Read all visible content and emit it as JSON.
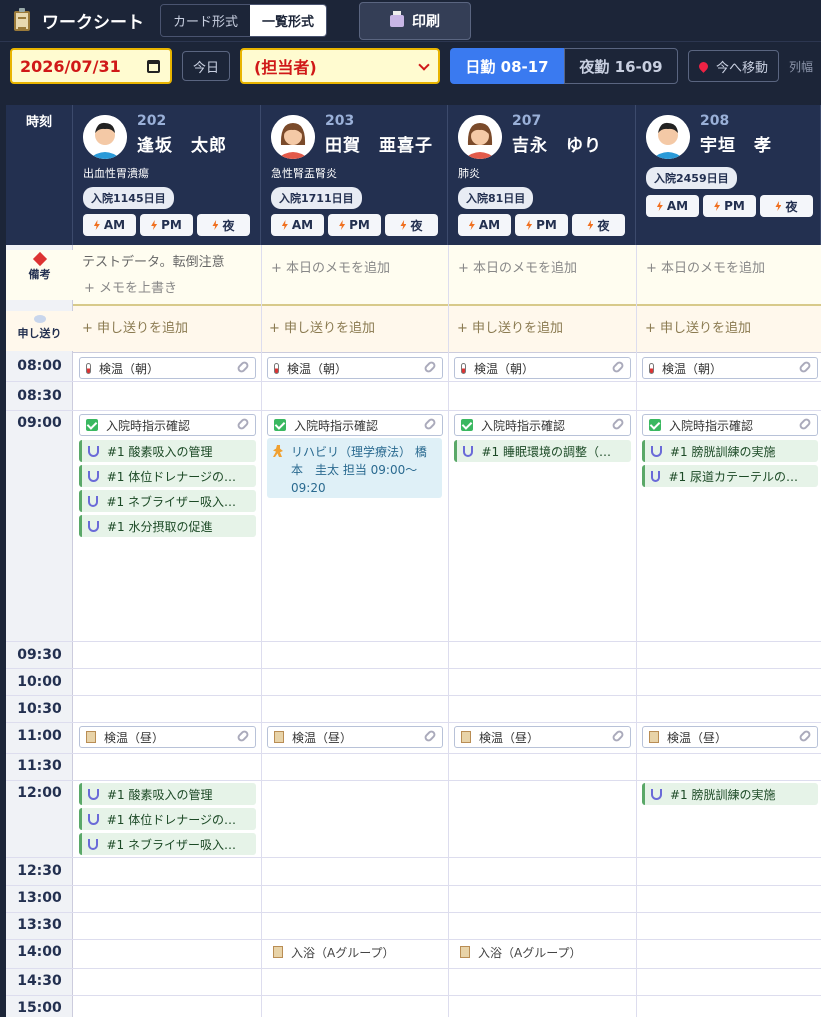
{
  "app": {
    "title": "ワークシート",
    "view_card": "カード形式",
    "view_list": "一覧形式",
    "print_label": "印刷"
  },
  "controls": {
    "date_value": "2026/07/31",
    "today_label": "今日",
    "staff_value": "(担当者)",
    "shift_day_label": "日勤 08-17",
    "shift_night_label": "夜勤 16-09",
    "now_label": "今へ移動",
    "colwidth_label": "列幅"
  },
  "grid": {
    "time_header": "時刻",
    "memo_label": "備考",
    "handover_label": "申し送り"
  },
  "patients": [
    {
      "room": "202",
      "name": "逢坂　太郎",
      "diagnosis": "出血性胃潰瘍",
      "admission": "入院1145日目",
      "memo": "テストデータ。転倒注意",
      "memo_action": "+ メモを上書き",
      "handover": "+ 申し送りを追加"
    },
    {
      "room": "203",
      "name": "田賀　亜喜子",
      "diagnosis": "急性腎盂腎炎",
      "admission": "入院1711日目",
      "memo": "+ 本日のメモを追加",
      "handover": "+ 申し送りを追加"
    },
    {
      "room": "207",
      "name": "吉永　ゆり",
      "diagnosis": "肺炎",
      "admission": "入院81日目",
      "memo": "+ 本日のメモを追加",
      "handover": "+ 申し送りを追加"
    },
    {
      "room": "208",
      "name": "宇垣　孝",
      "diagnosis": "",
      "admission": "入院2459日目",
      "memo": "+ 本日のメモを追加",
      "handover": "+ 申し送りを追加"
    }
  ],
  "shift_buttons": [
    "AM",
    "PM",
    "夜"
  ],
  "times": [
    "08:00",
    "08:30",
    "09:00",
    "09:30",
    "10:00",
    "10:30",
    "11:00",
    "11:30",
    "12:00",
    "12:30",
    "13:00",
    "13:30",
    "14:00",
    "14:30",
    "15:00"
  ],
  "tasks": {
    "temp_morning": "検温（朝）",
    "admit_check": "入院時指示確認",
    "p202_0900": [
      "#1 酸素吸入の管理",
      "#1 体位ドレナージの…",
      "#1 ネブライザー吸入…",
      "#1 水分摂取の促進"
    ],
    "p203_rehab": "リハビリ（理学療法） 橋本　圭太 担当 09:00～09:20",
    "p207_0900": [
      "#1 睡眠環境の調整（…"
    ],
    "p208_0900": [
      "#1 膀胱訓練の実施",
      "#1 尿道カテーテルの…"
    ],
    "temp_noon": "検温（昼）",
    "p202_1200": [
      "#1 酸素吸入の管理",
      "#1 体位ドレナージの…",
      "#1 ネブライザー吸入…"
    ],
    "p208_1200": [
      "#1 膀胱訓練の実施"
    ],
    "bath": "入浴（Aグループ）"
  }
}
